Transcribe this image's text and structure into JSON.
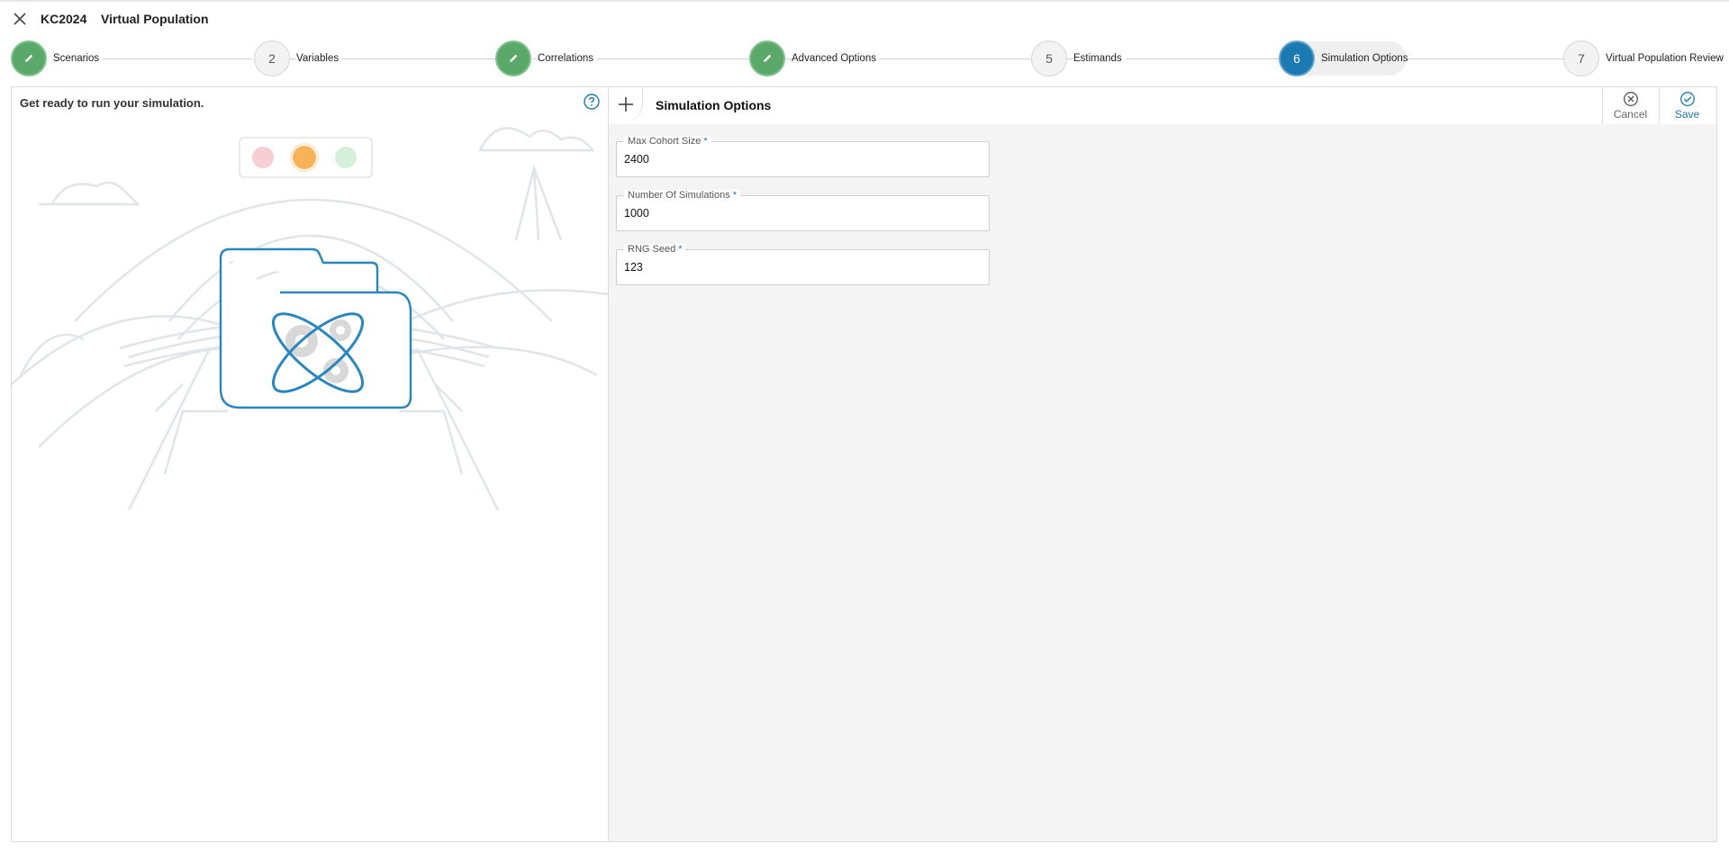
{
  "window": {
    "code": "KC2024",
    "title": "Virtual Population"
  },
  "stepper": {
    "steps": [
      {
        "label": "Scenarios",
        "badge": "",
        "state": "done"
      },
      {
        "label": "Variables",
        "badge": "2",
        "state": "todo"
      },
      {
        "label": "Correlations",
        "badge": "",
        "state": "done"
      },
      {
        "label": "Advanced Options",
        "badge": "",
        "state": "done"
      },
      {
        "label": "Estimands",
        "badge": "5",
        "state": "todo"
      },
      {
        "label": "Simulation Options",
        "badge": "6",
        "state": "active"
      },
      {
        "label": "Virtual Population Review",
        "badge": "7",
        "state": "todo"
      }
    ]
  },
  "left_panel": {
    "heading": "Get ready to run your simulation."
  },
  "form": {
    "title": "Simulation Options",
    "cancel_label": "Cancel",
    "save_label": "Save",
    "required_mark": "*",
    "fields": [
      {
        "label": "Max Cohort Size",
        "value": "2400"
      },
      {
        "label": "Number Of Simulations",
        "value": "1000"
      },
      {
        "label": "RNG Seed",
        "value": "123"
      }
    ]
  },
  "colors": {
    "accent": "#1b7ab1",
    "done_green": "#5aa86a",
    "traffic_red": "#f5c6cb",
    "traffic_amber": "#f9b25a",
    "traffic_green": "#cfeed6"
  },
  "icons": [
    "close-icon",
    "pencil-icon",
    "help-icon",
    "plus-icon",
    "cancel-circle-icon",
    "check-circle-icon",
    "folder-gears-icon"
  ]
}
